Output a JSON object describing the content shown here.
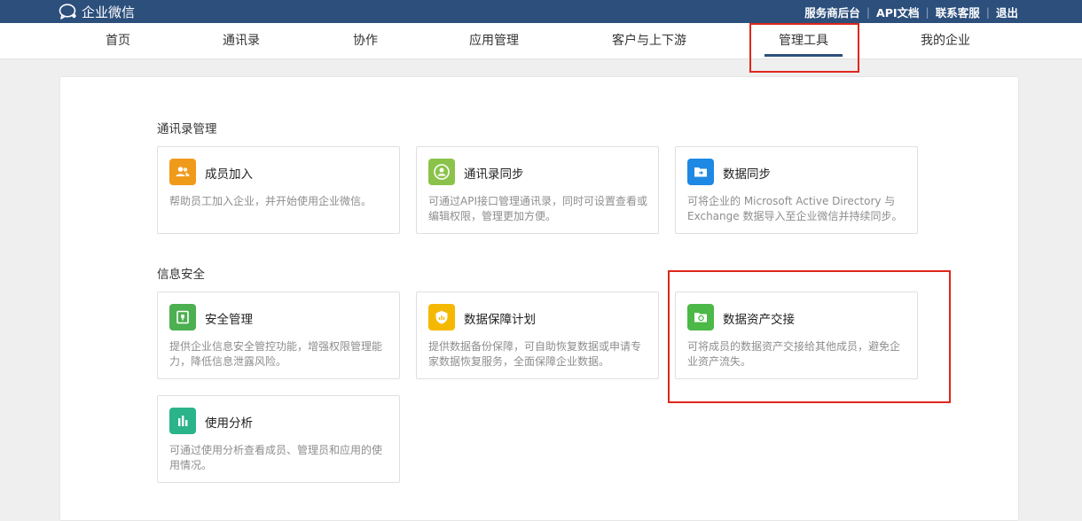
{
  "header": {
    "logo_text": "企业微信",
    "links": [
      "服务商后台",
      "API文档",
      "联系客服",
      "退出"
    ]
  },
  "nav": {
    "tabs": [
      {
        "label": "首页"
      },
      {
        "label": "通讯录"
      },
      {
        "label": "协作"
      },
      {
        "label": "应用管理"
      },
      {
        "label": "客户与上下游"
      },
      {
        "label": "管理工具",
        "active": true
      },
      {
        "label": "我的企业"
      }
    ]
  },
  "sections": [
    {
      "title": "通讯录管理",
      "cards": [
        {
          "title": "成员加入",
          "desc": "帮助员工加入企业，并开始使用企业微信。",
          "icon": "users-icon",
          "color": "#f09a1a"
        },
        {
          "title": "通讯录同步",
          "desc": "可通过API接口管理通讯录，同时可设置查看或编辑权限，管理更加方便。",
          "icon": "contact-sync-icon",
          "color": "#8bc34a"
        },
        {
          "title": "数据同步",
          "desc": "可将企业的 Microsoft Active Directory 与 Exchange 数据导入至企业微信并持续同步。",
          "icon": "folder-sync-icon",
          "color": "#1e88e5"
        }
      ]
    },
    {
      "title": "信息安全",
      "cards": [
        {
          "title": "安全管理",
          "desc": "提供企业信息安全管控功能，增强权限管理能力，降低信息泄露风险。",
          "icon": "safe-icon",
          "color": "#4caf50"
        },
        {
          "title": "数据保障计划",
          "desc": "提供数据备份保障，可自助恢复数据或申请专家数据恢复服务，全面保障企业数据。",
          "icon": "shield-icon",
          "color": "#f5b800"
        },
        {
          "title": "数据资产交接",
          "desc": "可将成员的数据资产交接给其他成员，避免企业资产流失。",
          "icon": "folder-transfer-icon",
          "color": "#4cb848"
        },
        {
          "title": "使用分析",
          "desc": "可通过使用分析查看成员、管理员和应用的使用情况。",
          "icon": "bar-chart-icon",
          "color": "#2bb38a"
        }
      ]
    }
  ]
}
